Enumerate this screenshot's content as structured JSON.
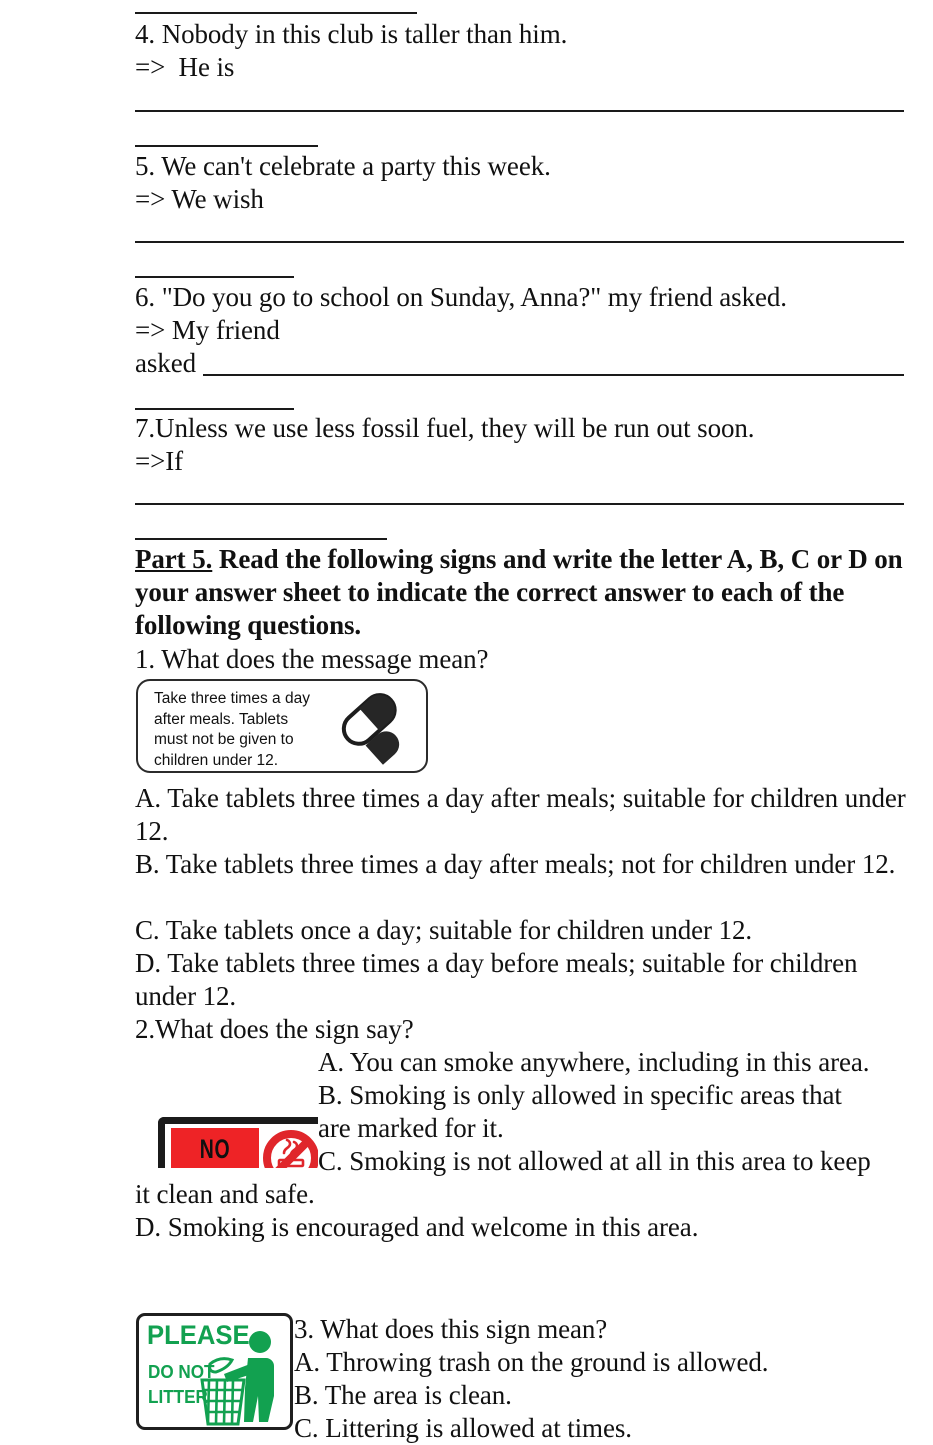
{
  "document": {
    "type": "english-worksheet-page",
    "sentence_transformations": [
      {
        "number": "4.",
        "prompt": "4. Nobody in this club is taller than him.",
        "answer_lead": "=>  He is"
      },
      {
        "number": "5.",
        "prompt": "5. We can't celebrate a party this week.",
        "answer_lead": "=> We wish"
      },
      {
        "number": "6.",
        "prompt": "6. \"Do you go to school on Sunday, Anna?\" my friend asked.",
        "answer_lead": "=> My friend",
        "answer_lead_second": "asked"
      },
      {
        "number": "7.",
        "prompt": "7.Unless we use less fossil fuel, they will be run out soon.",
        "answer_lead": "=>If"
      }
    ],
    "part5": {
      "label": "Part 5.",
      "instruction": " Read the following signs and write the letter A, B, C or D on your answer sheet to indicate the correct answer to each of the following questions.",
      "questions": [
        {
          "number": "1.",
          "stem": "1. What does the message mean?",
          "sign": {
            "name": "medicine-label-sign",
            "lines": [
              "Take three times a day",
              "after meals. Tablets",
              "must not be given to",
              "children under 12."
            ],
            "icon": "pill-capsule-icon"
          },
          "options": [
            "A. Take tablets three times a day after meals; suitable for children under 12.",
            "B. Take tablets three times a day after meals; not for children under 12.",
            "C. Take tablets once a day; suitable for children under 12.",
            "D. Take tablets three times a day before meals; suitable for children under 12."
          ]
        },
        {
          "number": "2.",
          "stem": "2.What does the sign say?",
          "sign": {
            "name": "no-smoking-sign",
            "text": "NO",
            "icon": "no-smoking-icon",
            "colors": {
              "red": "#EE2326",
              "frame": "#1b1b1b"
            }
          },
          "options": [
            "A. You can smoke anywhere, including in this area.",
            "B. Smoking is only allowed in specific areas that are marked for it.",
            "C. Smoking is not allowed at all in this area to keep it clean and safe.",
            "D. Smoking is encouraged and welcome in this area."
          ],
          "option_fragments": {
            "a": "A. You can smoke anywhere, including in this area.",
            "b1": "B. Smoking is only allowed in specific areas that",
            "b2": "are marked for it.",
            "c1": "C. Smoking is not allowed at all in this area to keep",
            "c2": "it clean and safe.",
            "d": "D. Smoking is encouraged and welcome in this area."
          }
        },
        {
          "number": "3.",
          "stem": "3. What does this sign mean?",
          "sign": {
            "name": "do-not-litter-sign",
            "line1": "PLEASE",
            "line2": "DO NOT",
            "line3": "LITTER",
            "icon": "person-throwing-trash-icon",
            "colors": {
              "green": "#12A150",
              "frame": "#1f1f1f"
            }
          },
          "options": [
            "A. Throwing trash on the ground is allowed.",
            "B. The area is clean.",
            "C. Littering is allowed at times."
          ]
        }
      ]
    }
  }
}
